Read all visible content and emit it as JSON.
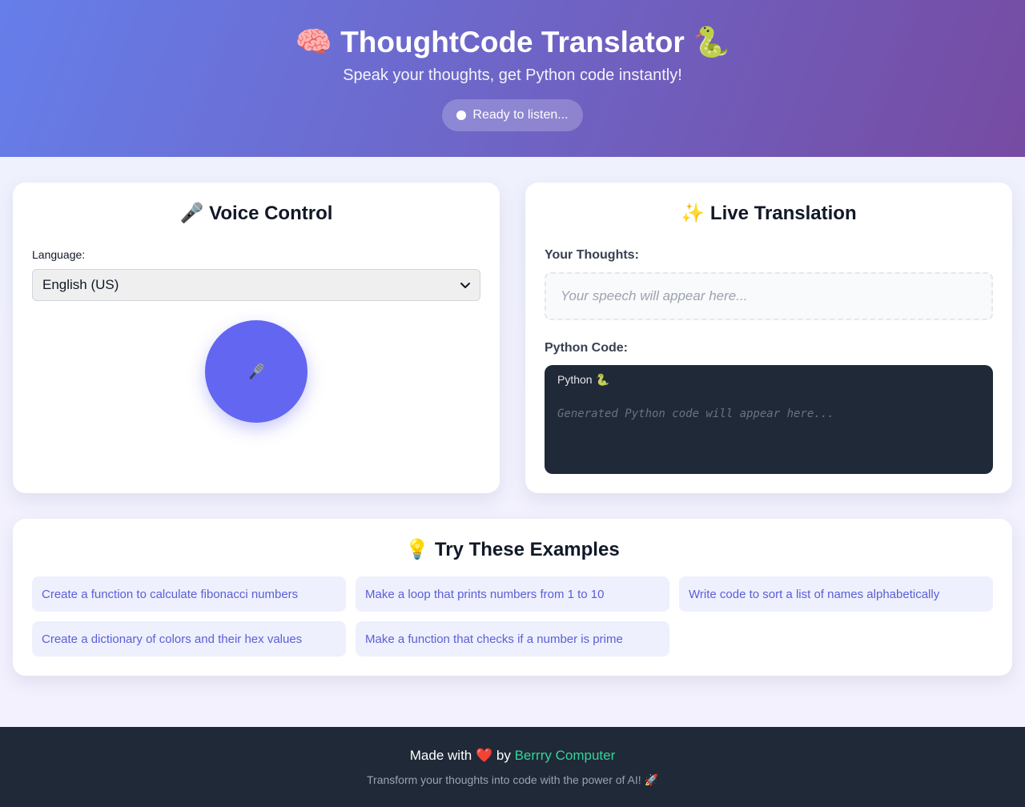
{
  "header": {
    "title": "🧠 ThoughtCode Translator 🐍",
    "subtitle": "Speak your thoughts, get Python code instantly!",
    "status": "Ready to listen..."
  },
  "voice_control": {
    "title": "🎤 Voice Control",
    "language_label": "Language:",
    "language_selected": "English (US)",
    "mic_icon": "🎤"
  },
  "live_translation": {
    "title": "✨ Live Translation",
    "thoughts_label": "Your Thoughts:",
    "thoughts_placeholder": "Your speech will appear here...",
    "code_label": "Python Code:",
    "code_language": "Python 🐍",
    "code_placeholder": "Generated Python code will appear here..."
  },
  "examples": {
    "title": "💡 Try These Examples",
    "items": [
      "Create a function to calculate fibonacci numbers",
      "Make a loop that prints numbers from 1 to 10",
      "Write code to sort a list of names alphabetically",
      "Create a dictionary of colors and their hex values",
      "Make a function that checks if a number is prime"
    ]
  },
  "footer": {
    "made_with": "Made with",
    "heart": "❤️",
    "by": "by",
    "link_text": "Berrry Computer",
    "tagline": "Transform your thoughts into code with the power of AI! 🚀"
  },
  "colors": {
    "header_gradient_start": "#667eea",
    "header_gradient_end": "#764ba2",
    "accent": "#6366f1",
    "footer_bg": "#1f2937",
    "link": "#34d399"
  }
}
